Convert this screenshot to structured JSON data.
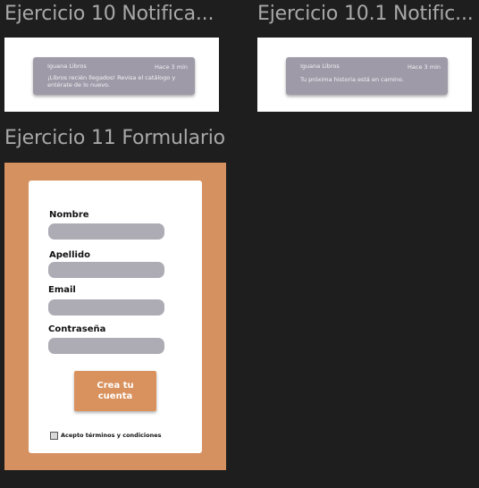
{
  "frames": {
    "ej10": {
      "title": "Ejercicio 10 Notifica...",
      "notification": {
        "app": "Iguana Libros",
        "time": "Hace 3 min",
        "line1": "¡Libros recién llegados! Revisa el catálogo y",
        "line2": "entérate de lo nuevo."
      }
    },
    "ej101": {
      "title": "Ejercicio 10.1 Notific...",
      "notification": {
        "app": "Iguana Libros",
        "time": "Hace 3 min",
        "message": "Tu próxima historia está en camino."
      }
    },
    "ej11": {
      "title": "Ejercicio 11 Formulario",
      "form": {
        "nombre_label": "Nombre",
        "apellido_label": "Apellido",
        "email_label": "Email",
        "password_label": "Contraseña",
        "submit_line1": "Crea tu",
        "submit_line2": "cuenta",
        "terms_label": "Acepto términos y condiciones"
      }
    }
  },
  "colors": {
    "canvas": "#1e1e1e",
    "frame_title": "#a8a8a8",
    "notification_bg": "#9e9aa8",
    "form_bg": "#d69161",
    "input_bg": "#adabb4",
    "button_bg": "#d9925e"
  }
}
